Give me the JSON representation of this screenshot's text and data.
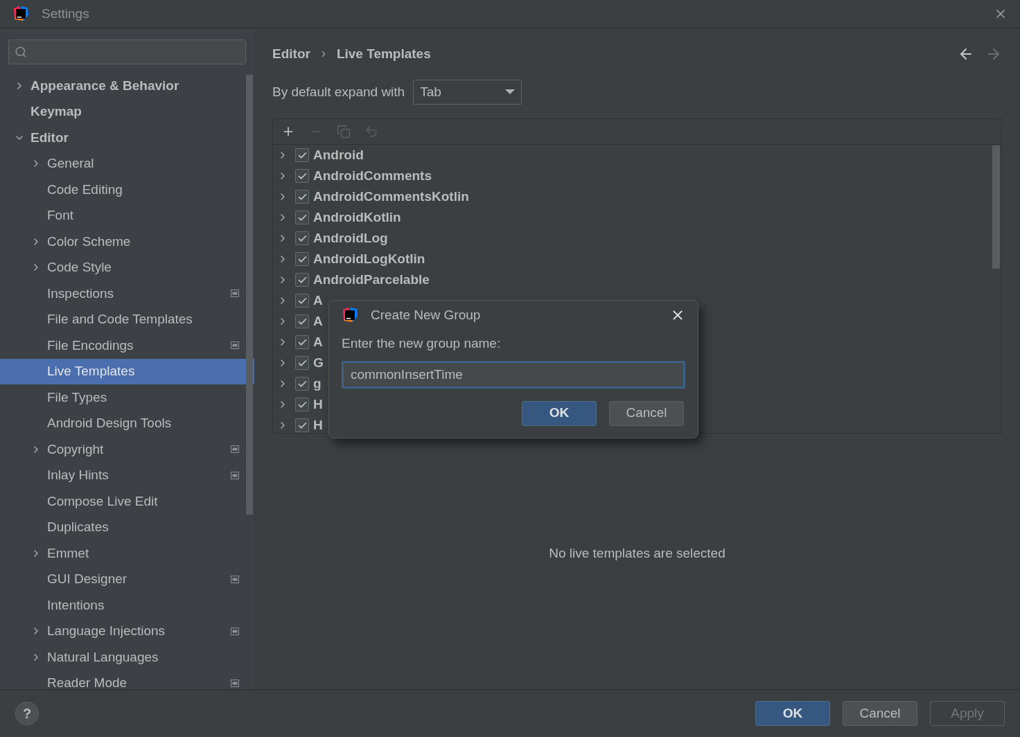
{
  "window": {
    "title": "Settings"
  },
  "sidebar": {
    "items": [
      {
        "label": "Appearance & Behavior",
        "bold": true,
        "expanded": false,
        "selected": false
      },
      {
        "label": "Keymap",
        "bold": true,
        "selected": false
      },
      {
        "label": "Editor",
        "bold": true,
        "expanded": true,
        "selected": false,
        "children": [
          {
            "label": "General",
            "expanded": false,
            "selected": false
          },
          {
            "label": "Code Editing",
            "selected": false
          },
          {
            "label": "Font",
            "selected": false
          },
          {
            "label": "Color Scheme",
            "expanded": false,
            "selected": false
          },
          {
            "label": "Code Style",
            "expanded": false,
            "selected": false
          },
          {
            "label": "Inspections",
            "project_scope": true,
            "selected": false
          },
          {
            "label": "File and Code Templates",
            "selected": false
          },
          {
            "label": "File Encodings",
            "project_scope": true,
            "selected": false
          },
          {
            "label": "Live Templates",
            "selected": true
          },
          {
            "label": "File Types",
            "selected": false
          },
          {
            "label": "Android Design Tools",
            "selected": false
          },
          {
            "label": "Copyright",
            "expanded": false,
            "project_scope": true,
            "selected": false
          },
          {
            "label": "Inlay Hints",
            "project_scope": true,
            "selected": false
          },
          {
            "label": "Compose Live Edit",
            "selected": false
          },
          {
            "label": "Duplicates",
            "selected": false
          },
          {
            "label": "Emmet",
            "expanded": false,
            "selected": false
          },
          {
            "label": "GUI Designer",
            "project_scope": true,
            "selected": false
          },
          {
            "label": "Intentions",
            "selected": false
          },
          {
            "label": "Language Injections",
            "expanded": false,
            "project_scope": true,
            "selected": false
          },
          {
            "label": "Natural Languages",
            "expanded": false,
            "selected": false
          },
          {
            "label": "Reader Mode",
            "project_scope": true,
            "selected": false
          }
        ]
      }
    ]
  },
  "breadcrumb": [
    "Editor",
    "Live Templates"
  ],
  "expand_with": {
    "label": "By default expand with",
    "value": "Tab"
  },
  "templates": [
    {
      "name": "Android",
      "checked": true
    },
    {
      "name": "AndroidComments",
      "checked": true
    },
    {
      "name": "AndroidCommentsKotlin",
      "checked": true
    },
    {
      "name": "AndroidKotlin",
      "checked": true
    },
    {
      "name": "AndroidLog",
      "checked": true
    },
    {
      "name": "AndroidLogKotlin",
      "checked": true
    },
    {
      "name": "AndroidParcelable",
      "checked": true
    },
    {
      "name": "A",
      "checked": true
    },
    {
      "name": "A",
      "checked": true
    },
    {
      "name": "A",
      "checked": true
    },
    {
      "name": "G",
      "checked": true
    },
    {
      "name": "g",
      "checked": true
    },
    {
      "name": "H",
      "checked": true
    },
    {
      "name": "H",
      "checked": true
    }
  ],
  "empty_message": "No live templates are selected",
  "dialog": {
    "title": "Create New Group",
    "prompt": "Enter the new group name:",
    "value": "commonInsertTime",
    "buttons": [
      {
        "label": "OK",
        "default": true
      },
      {
        "label": "Cancel",
        "default": false
      }
    ]
  },
  "footer": {
    "help": "?",
    "buttons": [
      {
        "label": "OK",
        "default": true,
        "disabled": false
      },
      {
        "label": "Cancel",
        "default": false,
        "disabled": false
      },
      {
        "label": "Apply",
        "default": false,
        "disabled": true
      }
    ]
  }
}
